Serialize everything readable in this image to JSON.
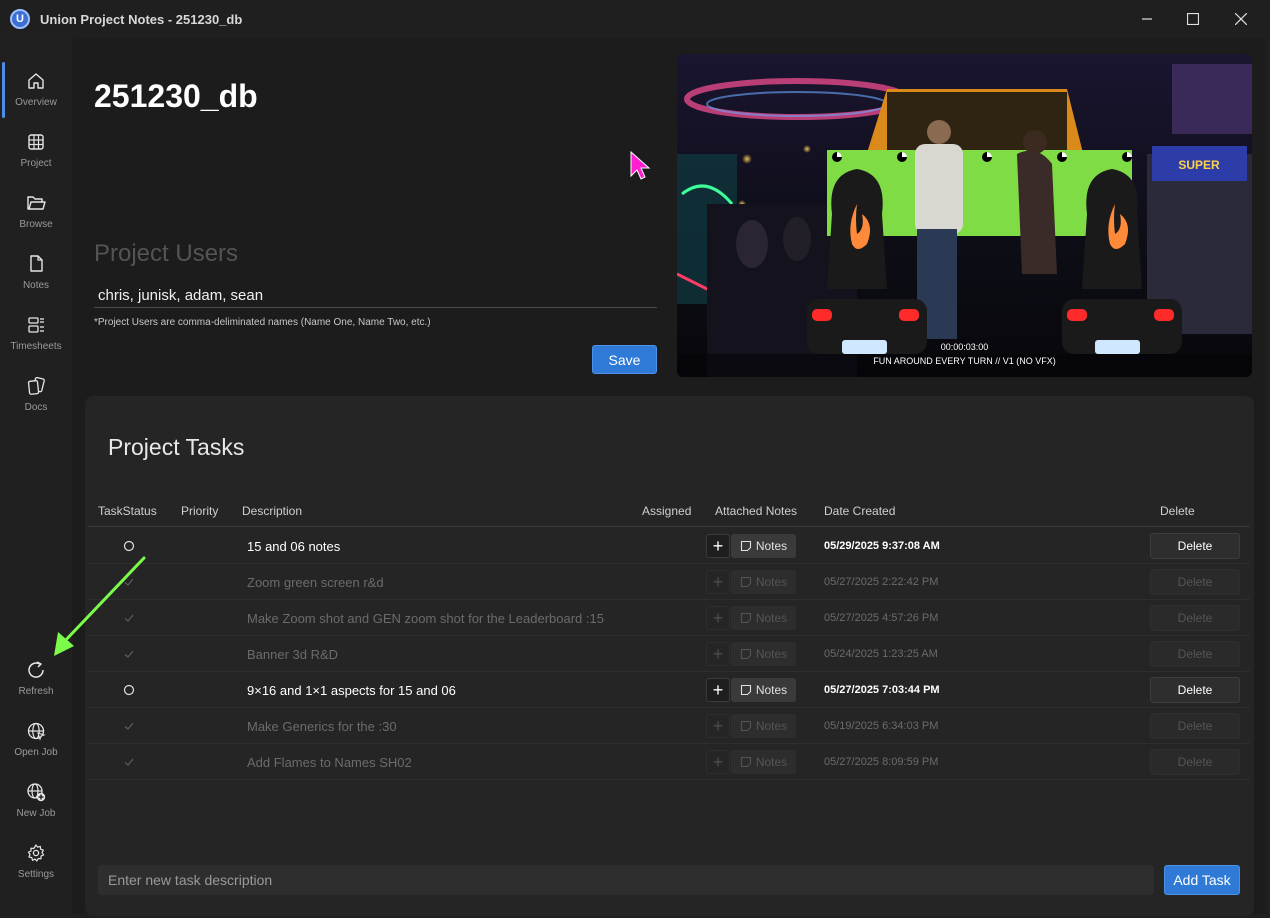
{
  "window": {
    "title": "Union Project Notes - 251230_db",
    "logo_letter": "U"
  },
  "sidebar": {
    "top_items": [
      {
        "label": "Overview",
        "icon": "home-icon",
        "active": true
      },
      {
        "label": "Project",
        "icon": "grid-icon"
      },
      {
        "label": "Browse",
        "icon": "folder-icon"
      },
      {
        "label": "Notes",
        "icon": "notes-icon"
      },
      {
        "label": "Timesheets",
        "icon": "timesheet-icon"
      },
      {
        "label": "Docs",
        "icon": "docs-icon"
      }
    ],
    "bottom_items": [
      {
        "label": "Refresh",
        "icon": "refresh-icon"
      },
      {
        "label": "Open Job",
        "icon": "globe-icon"
      },
      {
        "label": "New Job",
        "icon": "globe-plus-icon"
      },
      {
        "label": "Settings",
        "icon": "gear-icon"
      }
    ]
  },
  "overview": {
    "project_name": "251230_db",
    "users_heading": "Project Users",
    "users_value": "chris, junisk, adam, sean",
    "users_hint": "*Project Users are comma-deliminated names (Name One, Name Two, etc.)",
    "save_label": "Save"
  },
  "thumbnail": {
    "timecode": "00:00:03:00",
    "caption": "FUN AROUND EVERY TURN // V1 (NO VFX)"
  },
  "tasks": {
    "title": "Project Tasks",
    "columns": {
      "status": "TaskStatus",
      "priority": "Priority",
      "description": "Description",
      "assigned": "Assigned",
      "attached": "Attached Notes",
      "date": "Date Created",
      "delete": "Delete"
    },
    "notes_label": "Notes",
    "delete_label": "Delete",
    "rows": [
      {
        "done": false,
        "description": "15 and 06 notes",
        "date": "05/29/2025 9:37:08 AM"
      },
      {
        "done": true,
        "description": "Zoom green screen r&d",
        "date": "05/27/2025 2:22:42 PM"
      },
      {
        "done": true,
        "description": "Make Zoom shot and GEN zoom shot for the Leaderboard :15",
        "date": "05/27/2025 4:57:26 PM"
      },
      {
        "done": true,
        "description": "Banner 3d R&D",
        "date": "05/24/2025 1:23:25 AM"
      },
      {
        "done": false,
        "description": "9×16 and 1×1 aspects for 15 and 06",
        "date": "05/27/2025 7:03:44 PM"
      },
      {
        "done": true,
        "description": "Make Generics for the :30",
        "date": "05/19/2025 6:34:03 PM"
      },
      {
        "done": true,
        "description": "Add Flames to Names SH02",
        "date": "05/27/2025 8:09:59 PM"
      }
    ],
    "new_task_placeholder": "Enter new task description",
    "add_task_label": "Add Task"
  },
  "colors": {
    "accent": "#2f7ad6",
    "annotation_arrow": "#7CFC4A",
    "cursor": "#ff1fd0"
  }
}
